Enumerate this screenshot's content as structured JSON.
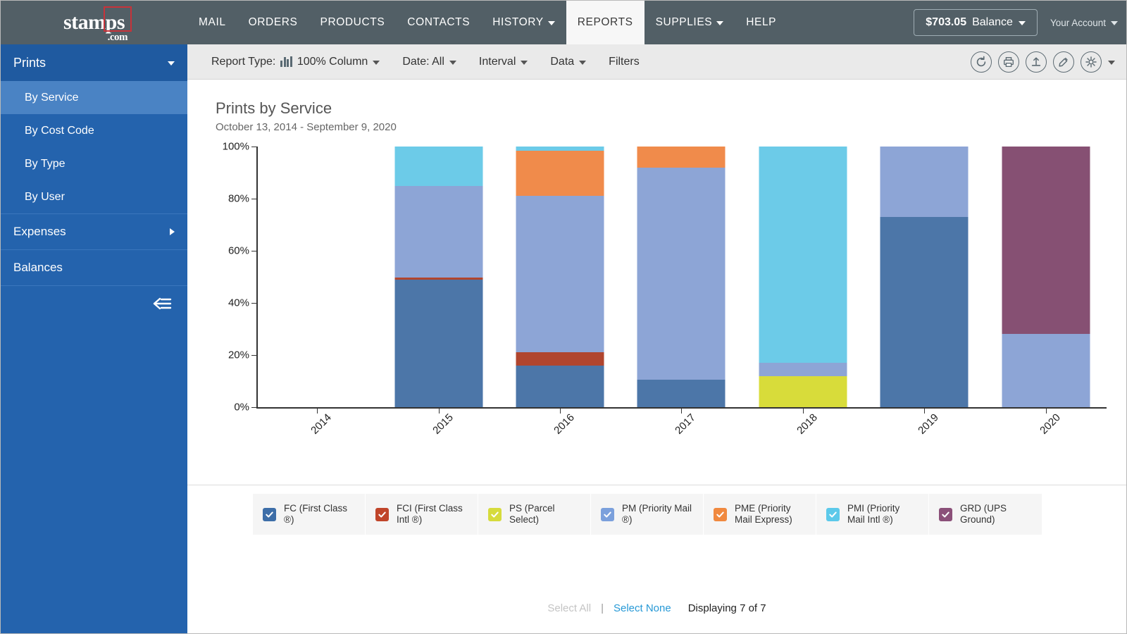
{
  "header": {
    "logo": {
      "main": "stamps",
      "suffix": ".com",
      "icon": "stamps-logo"
    },
    "nav": [
      {
        "label": "MAIL",
        "has_caret": false,
        "active": false
      },
      {
        "label": "ORDERS",
        "has_caret": false,
        "active": false
      },
      {
        "label": "PRODUCTS",
        "has_caret": false,
        "active": false
      },
      {
        "label": "CONTACTS",
        "has_caret": false,
        "active": false
      },
      {
        "label": "HISTORY",
        "has_caret": true,
        "active": false
      },
      {
        "label": "REPORTS",
        "has_caret": false,
        "active": true
      },
      {
        "label": "SUPPLIES",
        "has_caret": true,
        "active": false
      },
      {
        "label": "HELP",
        "has_caret": false,
        "active": false
      }
    ],
    "balance_amount": "$703.05",
    "balance_label": "Balance",
    "account_label": "Your Account"
  },
  "sidebar": {
    "section_title": "Prints",
    "items": [
      {
        "label": "By Service",
        "selected": true
      },
      {
        "label": "By Cost Code",
        "selected": false
      },
      {
        "label": "By Type",
        "selected": false
      },
      {
        "label": "By User",
        "selected": false
      }
    ],
    "groups": [
      {
        "label": "Expenses",
        "expandable": true
      },
      {
        "label": "Balances",
        "expandable": false
      }
    ],
    "collapse_icon": "collapse-sidebar-icon"
  },
  "toolbar": {
    "report_type_label": "Report Type:",
    "report_type_value": "100% Column",
    "date_label": "Date: All",
    "interval_label": "Interval",
    "data_label": "Data",
    "filters_label": "Filters",
    "icons": [
      {
        "name": "refresh-icon"
      },
      {
        "name": "print-icon"
      },
      {
        "name": "export-icon"
      },
      {
        "name": "feedback-icon"
      },
      {
        "name": "settings-gear-icon"
      }
    ]
  },
  "chart_data": {
    "type": "bar",
    "stacked": true,
    "normalized_100pct": true,
    "title": "Prints by Service",
    "subtitle": "October 13, 2014 - September 9, 2020",
    "xlabel": "",
    "ylabel": "",
    "ylim": [
      0,
      100
    ],
    "ytick_labels": [
      "0%",
      "20%",
      "40%",
      "60%",
      "80%",
      "100%"
    ],
    "ytick_values": [
      0,
      20,
      40,
      60,
      80,
      100
    ],
    "grid": false,
    "legend_position": "bottom",
    "categories": [
      "2014",
      "2015",
      "2016",
      "2017",
      "2018",
      "2019",
      "2020"
    ],
    "series": [
      {
        "name": "FC (First Class ®)",
        "code": "FC",
        "color": "#4c76a8",
        "values": [
          0,
          49.0,
          16.0,
          10.5,
          0,
          73.0,
          0
        ]
      },
      {
        "name": "FCI (First Class Intl ®)",
        "code": "FCI",
        "color": "#b0452e",
        "values": [
          0,
          0.8,
          5.0,
          0,
          0,
          0,
          0
        ]
      },
      {
        "name": "PS (Parcel Select)",
        "code": "PS",
        "color": "#d8dc3a",
        "values": [
          0,
          0,
          0,
          0,
          12.0,
          0,
          0
        ]
      },
      {
        "name": "PM (Priority Mail ®)",
        "code": "PM",
        "color": "#8da5d6",
        "values": [
          0,
          35.2,
          60.0,
          81.5,
          5.0,
          27.0,
          28.0
        ]
      },
      {
        "name": "PME (Priority Mail Express)",
        "code": "PME",
        "color": "#f08b4b",
        "values": [
          0,
          0,
          17.5,
          8.0,
          0,
          0,
          0
        ]
      },
      {
        "name": "PMI (Priority Mail Intl ®)",
        "code": "PMI",
        "color": "#6ccbe8",
        "values": [
          0,
          15.0,
          1.5,
          0,
          83.0,
          0,
          0
        ]
      },
      {
        "name": "GRD (UPS Ground)",
        "code": "GRD",
        "color": "#865073",
        "values": [
          0,
          0,
          0,
          0,
          0,
          0,
          72.0
        ]
      }
    ]
  },
  "legend": {
    "items": [
      {
        "label": "FC (First Class ®)",
        "color": "#3d6ea8",
        "checked": true
      },
      {
        "label": "FCI (First Class Intl ®)",
        "color": "#c0452a",
        "checked": true
      },
      {
        "label": "PS (Parcel Select)",
        "color": "#d6db3c",
        "checked": true
      },
      {
        "label": "PM (Priority Mail ®)",
        "color": "#7ba0dc",
        "checked": true
      },
      {
        "label": "PME (Priority Mail Express)",
        "color": "#f0893f",
        "checked": true
      },
      {
        "label": "PMI (Priority Mail Intl ®)",
        "color": "#5cc9ea",
        "checked": true
      },
      {
        "label": "GRD (UPS Ground)",
        "color": "#8b5079",
        "checked": true
      }
    ]
  },
  "footer": {
    "select_all": "Select All",
    "separator": "|",
    "select_none": "Select None",
    "displaying": "Displaying 7 of 7"
  }
}
